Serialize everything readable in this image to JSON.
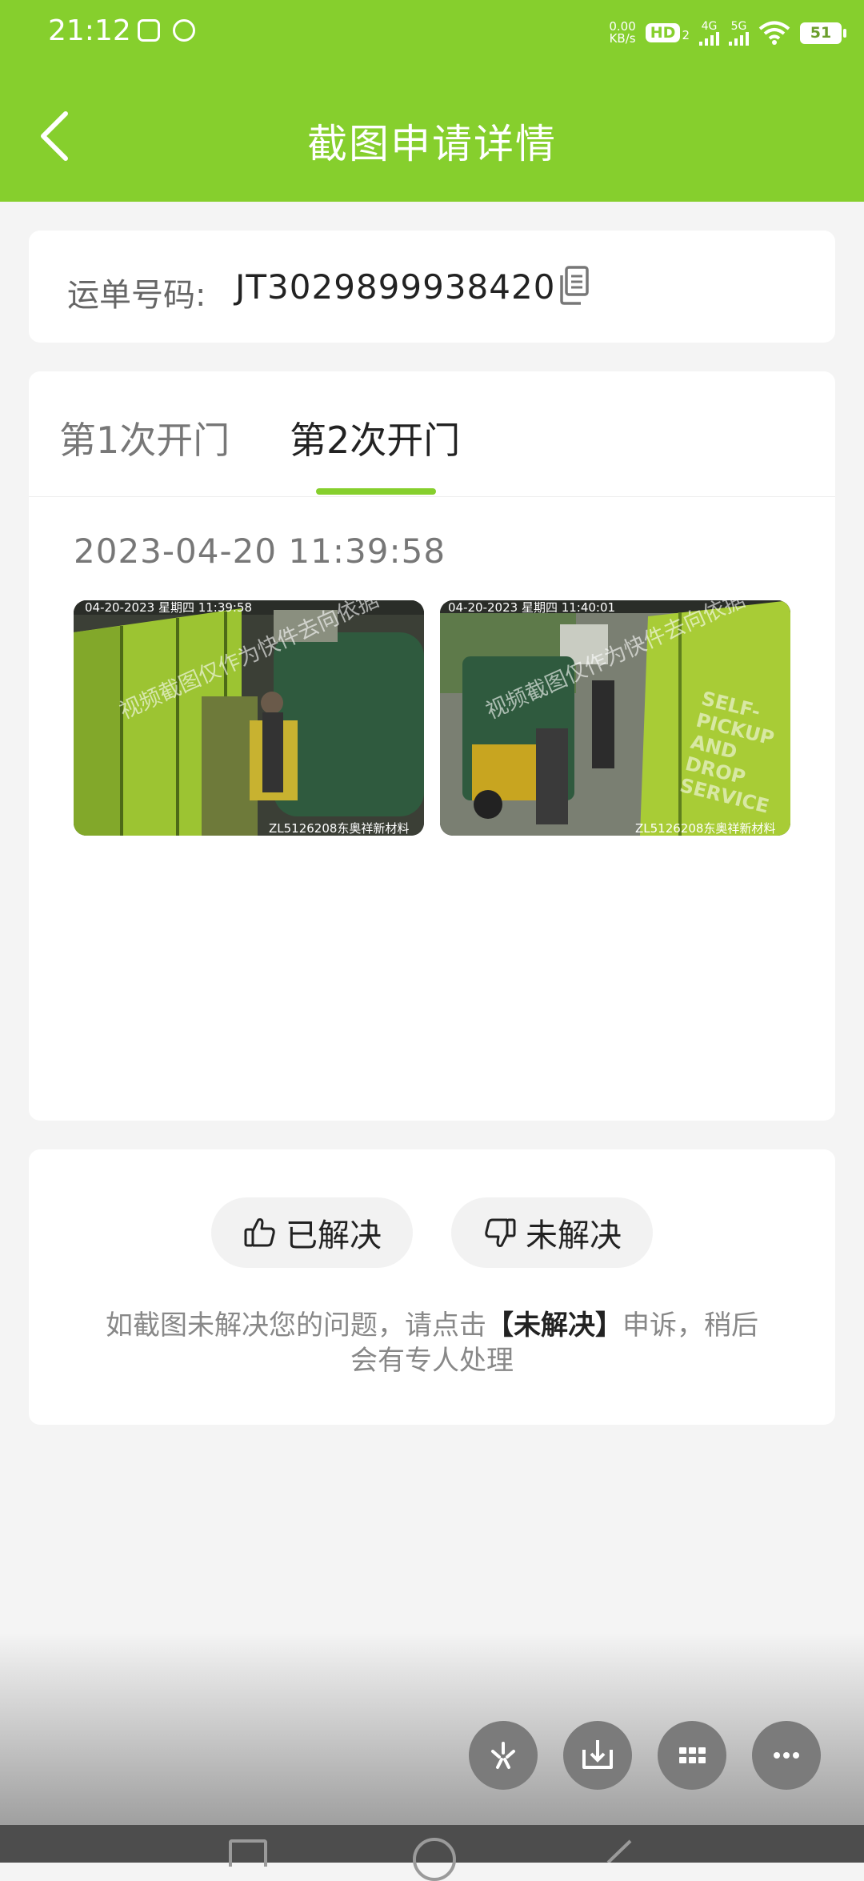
{
  "status_bar": {
    "time": "21:12",
    "net_speed_value": "0.00",
    "net_speed_unit": "KB/s",
    "hd_label": "HD",
    "hd_sub": "2",
    "net1": "4G",
    "net2": "5G",
    "battery": "51"
  },
  "nav": {
    "title": "截图申请详情"
  },
  "waybill": {
    "label": "运单号码:",
    "number": "JT3029899938420"
  },
  "tabs": [
    {
      "label": "第1次开门",
      "active": false
    },
    {
      "label": "第2次开门",
      "active": true
    }
  ],
  "record": {
    "datetime": "2023-04-20  11:39:58",
    "photos": [
      {
        "stamp": "04-20-2023 星期四 11:39:58",
        "watermark": "视频截图仅作为快件去向依据",
        "caption": "ZL5126208东奥祥新材料"
      },
      {
        "stamp": "04-20-2023 星期四 11:40:01",
        "watermark": "视频截图仅作为快件去向依据",
        "caption": "ZL5126208东奥祥新材料",
        "sign": "SELF-PICKUP AND DROP SERVICE"
      }
    ]
  },
  "feedback": {
    "resolved_label": "已解决",
    "unresolved_label": "未解决",
    "hint_before": "如截图未解决您的问题，请点击",
    "hint_bold": "【未解决】",
    "hint_after": "申诉，稍后会有专人处理"
  },
  "floating_actions": [
    "sparkle-icon",
    "download-icon",
    "grid-icon",
    "more-icon"
  ],
  "colors": {
    "brand": "#86cf2d",
    "background": "#f4f4f4"
  }
}
